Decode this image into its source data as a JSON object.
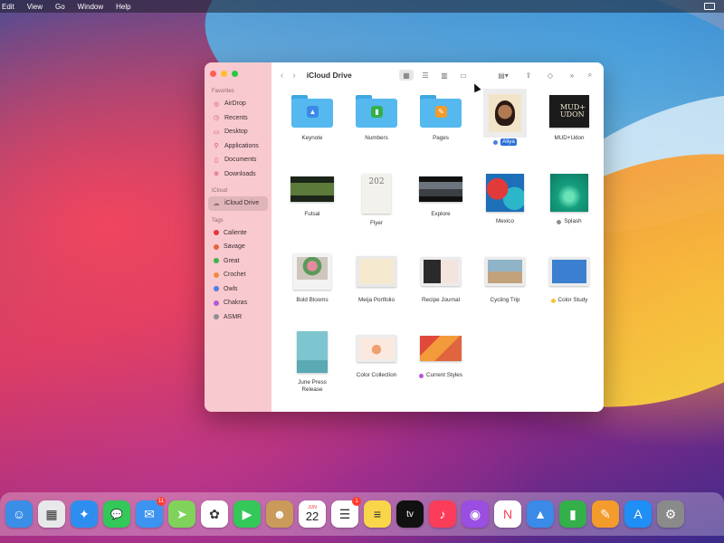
{
  "menu": [
    "Edit",
    "View",
    "Go",
    "Window",
    "Help"
  ],
  "sidebar": {
    "favorites_heading": "Favorites",
    "favorites": [
      {
        "label": "AirDrop",
        "icon": "airdrop-icon"
      },
      {
        "label": "Recents",
        "icon": "clock-icon"
      },
      {
        "label": "Desktop",
        "icon": "desktop-icon"
      },
      {
        "label": "Applications",
        "icon": "applications-icon"
      },
      {
        "label": "Documents",
        "icon": "document-icon"
      },
      {
        "label": "Downloads",
        "icon": "download-icon"
      }
    ],
    "icloud_heading": "iCloud",
    "icloud_items": [
      {
        "label": "iCloud Drive",
        "icon": "cloud-icon"
      }
    ],
    "tags_heading": "Tags",
    "tags": [
      {
        "label": "Caliente",
        "color": "#e0383e"
      },
      {
        "label": "Savage",
        "color": "#e5633c"
      },
      {
        "label": "Great",
        "color": "#3bb44a"
      },
      {
        "label": "Crochet",
        "color": "#f08b3a"
      },
      {
        "label": "Owls",
        "color": "#4c7fe3"
      },
      {
        "label": "Chakras",
        "color": "#b05ad8"
      },
      {
        "label": "ASMR",
        "color": "#8f8f8f"
      }
    ]
  },
  "toolbar": {
    "back": "‹",
    "forward": "›",
    "title": "iCloud Drive",
    "view_icons": [
      "grid-view-icon",
      "list-view-icon",
      "column-view-icon",
      "gallery-view-icon"
    ],
    "selected_view": "grid-view-icon",
    "actions": [
      "group-icon",
      "share-icon",
      "tag-icon",
      "more-icon",
      "search-icon"
    ]
  },
  "files": [
    {
      "label": "Keynote",
      "kind": "folder",
      "badge_color": "#3b8ae8",
      "badge_icon": "keynote-icon"
    },
    {
      "label": "Numbers",
      "kind": "folder",
      "badge_color": "#33b04a",
      "badge_icon": "numbers-icon"
    },
    {
      "label": "Pages",
      "kind": "folder",
      "badge_color": "#f39b2b",
      "badge_icon": "pages-icon"
    },
    {
      "label": "Aliya",
      "kind": "portrait",
      "selected": true,
      "tag_color": "#4c7fe3"
    },
    {
      "label": "MUD+Udon",
      "kind": "poster",
      "poster_text": "MUD+\nUDON"
    },
    {
      "label": "Futsal",
      "kind": "video-green"
    },
    {
      "label": "Flyer",
      "kind": "flyer",
      "flyer_text": "202"
    },
    {
      "label": "Explore",
      "kind": "video-dark"
    },
    {
      "label": "Mexico",
      "kind": "mexico"
    },
    {
      "label": "Splash",
      "kind": "splash",
      "tag_color": "#8f8f8f"
    },
    {
      "label": "Bold Blooms",
      "kind": "blooms"
    },
    {
      "label": "Meija Portfolio",
      "kind": "portfolio"
    },
    {
      "label": "Recipe Journal",
      "kind": "recipe"
    },
    {
      "label": "Cycling Trip",
      "kind": "cycling"
    },
    {
      "label": "Color Study",
      "kind": "colorstudy",
      "tag_color": "#f5c33b"
    },
    {
      "label": "June Press Release",
      "kind": "press"
    },
    {
      "label": "Color Collection",
      "kind": "collection"
    },
    {
      "label": "Current Styles",
      "kind": "styles",
      "tag_color": "#b05ad8"
    }
  ],
  "dock": [
    {
      "name": "finder",
      "color": "#3a8ee6",
      "glyph": "☺"
    },
    {
      "name": "launchpad",
      "color": "#e8e8ea",
      "glyph": "▦"
    },
    {
      "name": "safari",
      "color": "#2e8ef0",
      "glyph": "✦"
    },
    {
      "name": "messages",
      "color": "#34c759",
      "glyph": "💬"
    },
    {
      "name": "mail",
      "color": "#3d93f2",
      "glyph": "✉",
      "badge": "11"
    },
    {
      "name": "maps",
      "color": "#7fd35b",
      "glyph": "➤"
    },
    {
      "name": "photos",
      "color": "#ffffff",
      "glyph": "✿"
    },
    {
      "name": "facetime",
      "color": "#34c759",
      "glyph": "▶"
    },
    {
      "name": "contacts",
      "color": "#c99a5a",
      "glyph": "☻"
    },
    {
      "name": "calendar",
      "color": "#ffffff",
      "glyph": "22",
      "month": "JUN"
    },
    {
      "name": "reminders",
      "color": "#ffffff",
      "glyph": "☰",
      "badge": "1"
    },
    {
      "name": "notes",
      "color": "#f9d54a",
      "glyph": "≡"
    },
    {
      "name": "tv",
      "color": "#111111",
      "glyph": "tv"
    },
    {
      "name": "music",
      "color": "#fb3d59",
      "glyph": "♪"
    },
    {
      "name": "podcasts",
      "color": "#9b4ee2",
      "glyph": "◉"
    },
    {
      "name": "news",
      "color": "#ffffff",
      "glyph": "N"
    },
    {
      "name": "keynote",
      "color": "#3b8ae8",
      "glyph": "▲"
    },
    {
      "name": "numbers",
      "color": "#33b04a",
      "glyph": "▮"
    },
    {
      "name": "pages",
      "color": "#f39b2b",
      "glyph": "✎"
    },
    {
      "name": "app-store",
      "color": "#1f8ef5",
      "glyph": "A"
    },
    {
      "name": "system-preferences",
      "color": "#8a8a8a",
      "glyph": "⚙"
    }
  ]
}
